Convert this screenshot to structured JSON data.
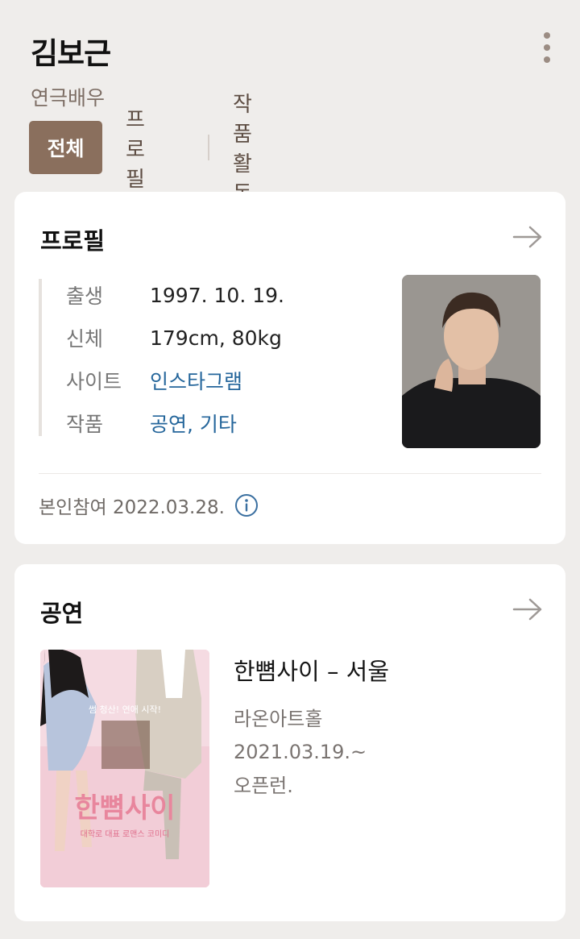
{
  "header": {
    "name": "김보근",
    "role": "연극배우",
    "tabs": [
      "전체",
      "프로필",
      "작품활동"
    ]
  },
  "profile": {
    "title": "프로필",
    "rows": [
      {
        "label": "출생",
        "value": "1997. 10. 19."
      },
      {
        "label": "신체",
        "value": "179cm, 80kg"
      },
      {
        "label": "사이트",
        "value": "인스타그램"
      },
      {
        "label": "작품",
        "value": "공연, 기타"
      }
    ],
    "footer": "본인참여 2022.03.28."
  },
  "performance": {
    "title": "공연",
    "show": {
      "title": "한뼘사이 – 서울",
      "venue": "라온아트홀",
      "date": "2021.03.19.~",
      "run": "오픈런."
    },
    "poster": {
      "logo_text": "한뼘사이",
      "tagline": "썸 청산! 연애 시작!",
      "subtitle": "대학로 대표 로맨스 코미디"
    }
  },
  "colors": {
    "background": "#efedeb",
    "tab_active": "#8a6f5d",
    "link": "#25669b",
    "info_icon": "#3a6fa0"
  },
  "icons": [
    "more-vertical-icon",
    "arrow-right-icon",
    "info-icon"
  ]
}
